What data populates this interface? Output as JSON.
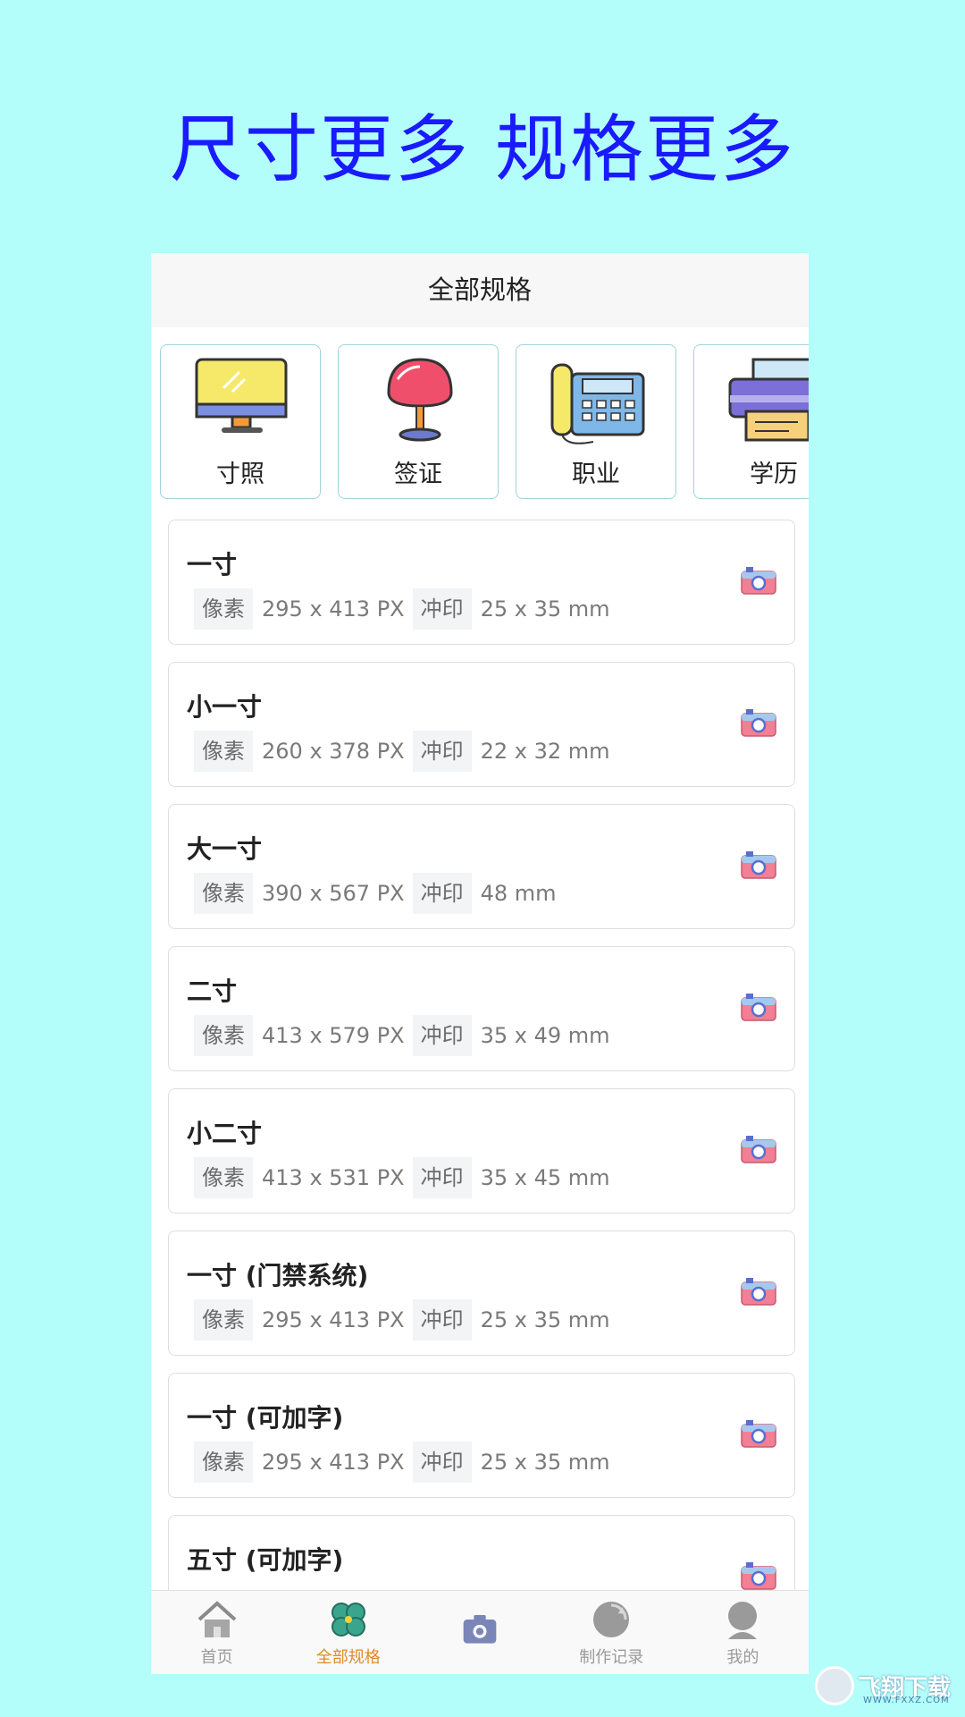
{
  "headline": "尺寸更多 规格更多",
  "nav": {
    "title": "全部规格"
  },
  "categories": [
    {
      "label": "寸照",
      "icon": "monitor-icon"
    },
    {
      "label": "签证",
      "icon": "chair-icon"
    },
    {
      "label": "职业",
      "icon": "telephone-icon"
    },
    {
      "label": "学历",
      "icon": "printer-icon"
    }
  ],
  "spec_labels": {
    "pixel": "像素",
    "print": "冲印"
  },
  "items": [
    {
      "title": "一寸",
      "pixels": "295 x 413 PX",
      "print": "25 x 35 mm"
    },
    {
      "title": "小一寸",
      "pixels": "260 x 378 PX",
      "print": "22 x 32 mm"
    },
    {
      "title": "大一寸",
      "pixels": "390 x 567 PX",
      "print": "48 mm"
    },
    {
      "title": "二寸",
      "pixels": "413 x 579 PX",
      "print": "35 x 49 mm"
    },
    {
      "title": "小二寸",
      "pixels": "413 x 531 PX",
      "print": "35 x 45 mm"
    },
    {
      "title": "一寸 (门禁系统)",
      "pixels": "295 x 413 PX",
      "print": "25 x 35 mm"
    },
    {
      "title": "一寸 (可加字)",
      "pixels": "295 x 413 PX",
      "print": "25 x 35 mm"
    },
    {
      "title": "五寸 (可加字)",
      "pixels": "",
      "print": ""
    }
  ],
  "tabs": [
    {
      "label": "首页",
      "icon": "home-icon",
      "active": false
    },
    {
      "label": "全部规格",
      "icon": "clover-icon",
      "active": true
    },
    {
      "label": "",
      "icon": "camera-icon",
      "active": false
    },
    {
      "label": "制作记录",
      "icon": "history-icon",
      "active": false
    },
    {
      "label": "我的",
      "icon": "profile-icon",
      "active": false
    }
  ],
  "watermark": {
    "text": "飞翔下载",
    "sub": "WWW.FXXZ.COM"
  },
  "colors": {
    "background": "#b3fdfb",
    "headline": "#1a1aff",
    "active_tab": "#e08a2a"
  }
}
